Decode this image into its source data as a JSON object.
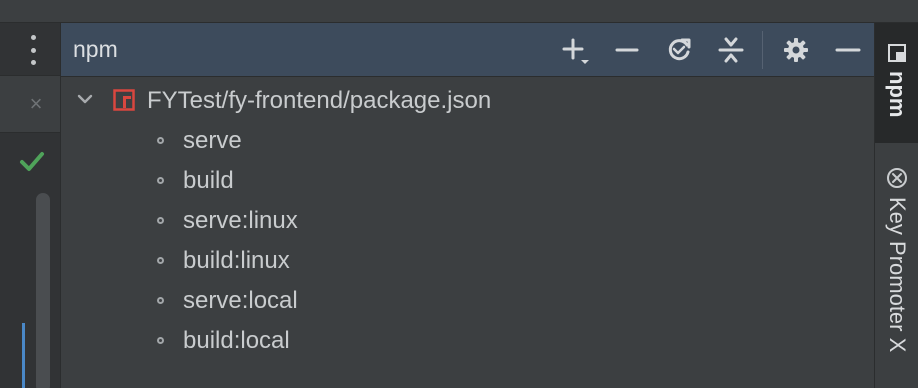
{
  "npm_panel": {
    "title": "npm",
    "toolbar": [
      {
        "name": "add-icon",
        "tooltip": "Add package.json"
      },
      {
        "name": "remove-icon",
        "tooltip": "Remove"
      },
      {
        "name": "refresh-icon",
        "tooltip": "Reload scripts"
      },
      {
        "name": "collapse-all-icon",
        "tooltip": "Collapse all"
      },
      {
        "name": "gear-icon",
        "tooltip": "Settings"
      },
      {
        "name": "hide-icon",
        "tooltip": "Hide"
      }
    ],
    "tree": {
      "root_label": "FYTest/fy-frontend/package.json",
      "scripts": [
        "serve",
        "build",
        "serve:linux",
        "build:linux",
        "serve:local",
        "build:local"
      ]
    }
  },
  "right_strip": {
    "tabs": [
      {
        "label": "npm",
        "active": true
      },
      {
        "label": "Key Promoter X",
        "active": false
      }
    ]
  },
  "colors": {
    "header_bg": "#3d4b5c",
    "panel_bg": "#3c3f41",
    "package_icon": "#d9473f",
    "check": "#4fa35a",
    "change_marker": "#4a88c7"
  }
}
